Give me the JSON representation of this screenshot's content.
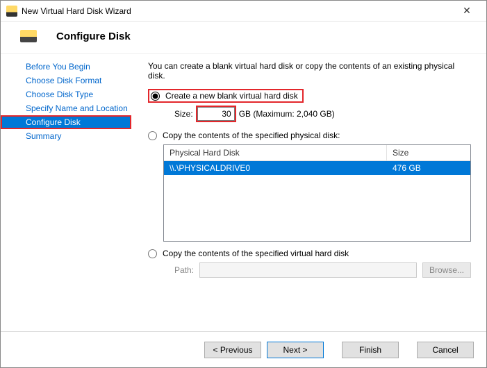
{
  "window": {
    "title": "New Virtual Hard Disk Wizard"
  },
  "page": {
    "heading": "Configure Disk"
  },
  "sidebar": {
    "items": [
      {
        "label": "Before You Begin"
      },
      {
        "label": "Choose Disk Format"
      },
      {
        "label": "Choose Disk Type"
      },
      {
        "label": "Specify Name and Location"
      },
      {
        "label": "Configure Disk"
      },
      {
        "label": "Summary"
      }
    ],
    "active_index": 4
  },
  "main": {
    "intro": "You can create a blank virtual hard disk or copy the contents of an existing physical disk.",
    "option_blank": {
      "label": "Create a new blank virtual hard disk",
      "size_label": "Size:",
      "size_value": "30",
      "size_unit_suffix": "GB (Maximum: 2,040 GB)"
    },
    "option_physical": {
      "label": "Copy the contents of the specified physical disk:",
      "columns": {
        "c1": "Physical Hard Disk",
        "c2": "Size"
      },
      "rows": [
        {
          "name": "\\\\.\\PHYSICALDRIVE0",
          "size": "476 GB"
        }
      ]
    },
    "option_virtual": {
      "label": "Copy the contents of the specified virtual hard disk",
      "path_label": "Path:",
      "path_value": "",
      "browse_label": "Browse..."
    }
  },
  "footer": {
    "previous": "< Previous",
    "next": "Next >",
    "finish": "Finish",
    "cancel": "Cancel"
  }
}
